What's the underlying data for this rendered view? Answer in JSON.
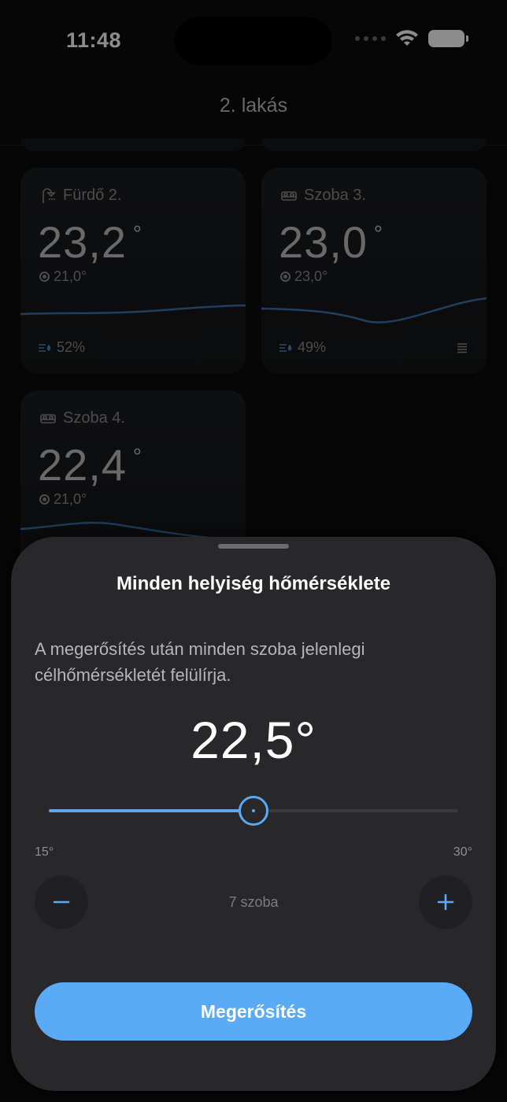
{
  "status_bar": {
    "time": "11:48"
  },
  "header": {
    "title": "2. lakás"
  },
  "rooms": [
    {
      "name": "Fürdő 2.",
      "icon": "shower-icon",
      "temperature": "23,2",
      "degree": "°",
      "target": "21,0°",
      "humidity": "52%"
    },
    {
      "name": "Szoba 3.",
      "icon": "bed-icon",
      "temperature": "23,0",
      "degree": "°",
      "target": "23,0°",
      "humidity": "49%"
    },
    {
      "name": "Szoba 4.",
      "icon": "bed-icon",
      "temperature": "22,4",
      "degree": "°",
      "target": "21,0°"
    }
  ],
  "sheet": {
    "title": "Minden helyiség hőmérséklete",
    "description": "A megerősítés után minden szoba jelenlegi célhőmérsékletét felülírja.",
    "value": "22,5°",
    "slider": {
      "min_label": "15°",
      "max_label": "30°",
      "min": 15,
      "max": 30,
      "value": 22.5
    },
    "room_count": "7 szoba",
    "confirm_label": "Megerősítés"
  },
  "colors": {
    "accent": "#5aaaf6",
    "background": "#0b0b0c",
    "sheet": "#28282b"
  }
}
